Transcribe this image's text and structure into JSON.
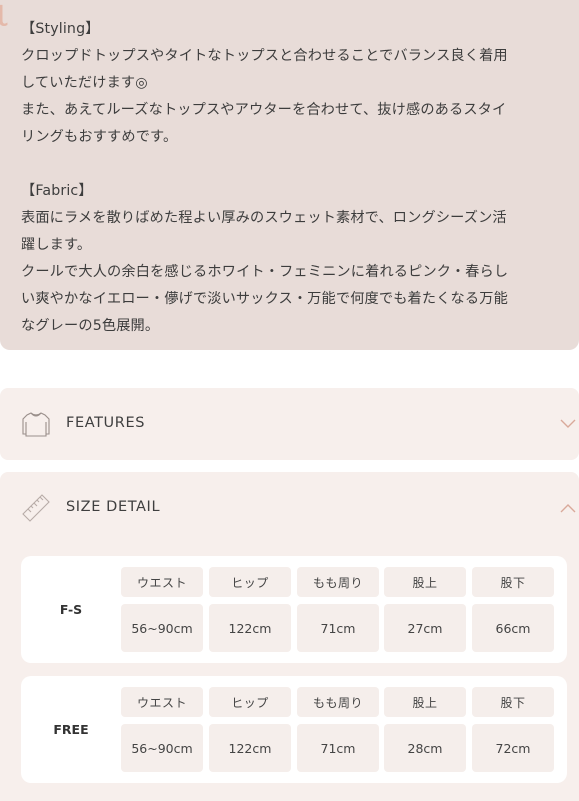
{
  "description": {
    "styling_heading": "【Styling】",
    "styling_line1": "クロップドトップスやタイトなトップスと合わせることでバランス良く着用",
    "styling_line2": "していただけます◎",
    "styling_line3": "また、あえてルーズなトップスやアウターを合わせて、抜け感のあるスタイ",
    "styling_line4": "リングもおすすめです。",
    "fabric_heading": "【Fabric】",
    "fabric_line1": "表面にラメを散りばめた程よい厚みのスウェット素材で、ロングシーズン活",
    "fabric_line2": "躍します。",
    "fabric_line3": "クールで大人の余白を感じるホワイト・フェミニンに着れるピンク・春らし",
    "fabric_line4": "い爽やかなイエロー・儚げで淡いサックス・万能で何度でも着たくなる万能",
    "fabric_line5": "なグレーの5色展開。"
  },
  "features": {
    "title": "FEATURES",
    "icon": "sweatshirt-icon",
    "expanded": false
  },
  "size_detail": {
    "title": "SIZE DETAIL",
    "icon": "ruler-icon",
    "expanded": true,
    "columns": [
      "ウエスト",
      "ヒップ",
      "もも周り",
      "股上",
      "股下"
    ],
    "sizes": [
      {
        "label": "F-S",
        "values": [
          "56~90cm",
          "122cm",
          "71cm",
          "27cm",
          "66cm"
        ]
      },
      {
        "label": "FREE",
        "values": [
          "56~90cm",
          "122cm",
          "71cm",
          "28cm",
          "72cm"
        ]
      }
    ]
  },
  "colors": {
    "panel_bg": "#e8dcd8",
    "section_bg": "#f7efec",
    "cell_bg": "#f5eeeb",
    "accent": "#e4b9aa"
  }
}
